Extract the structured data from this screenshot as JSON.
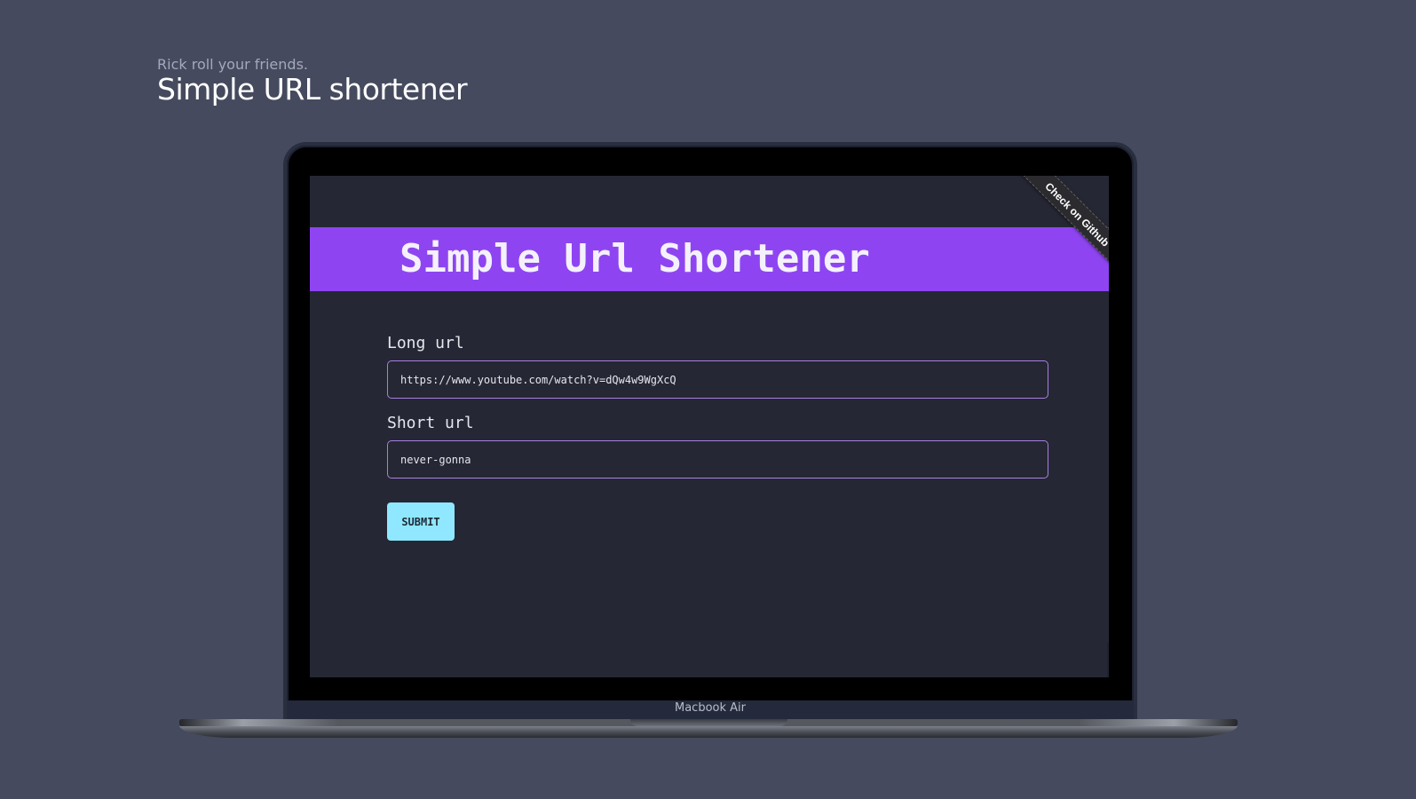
{
  "header": {
    "tagline": "Rick roll your friends.",
    "title": "Simple URL shortener"
  },
  "device": {
    "label": "Macbook Air"
  },
  "app": {
    "title": "Simple Url Shortener",
    "ribbon": "Check on Github",
    "form": {
      "long_url_label": "Long url",
      "long_url_value": "https://www.youtube.com/watch?v=dQw4w9WgXcQ",
      "short_url_label": "Short url",
      "short_url_value": "never-gonna",
      "submit_label": "SUBMIT"
    }
  },
  "colors": {
    "background": "#454a5e",
    "banner": "#8e45f1",
    "screen": "#252734",
    "input_border": "#a880e0",
    "button": "#8fe8ff"
  }
}
